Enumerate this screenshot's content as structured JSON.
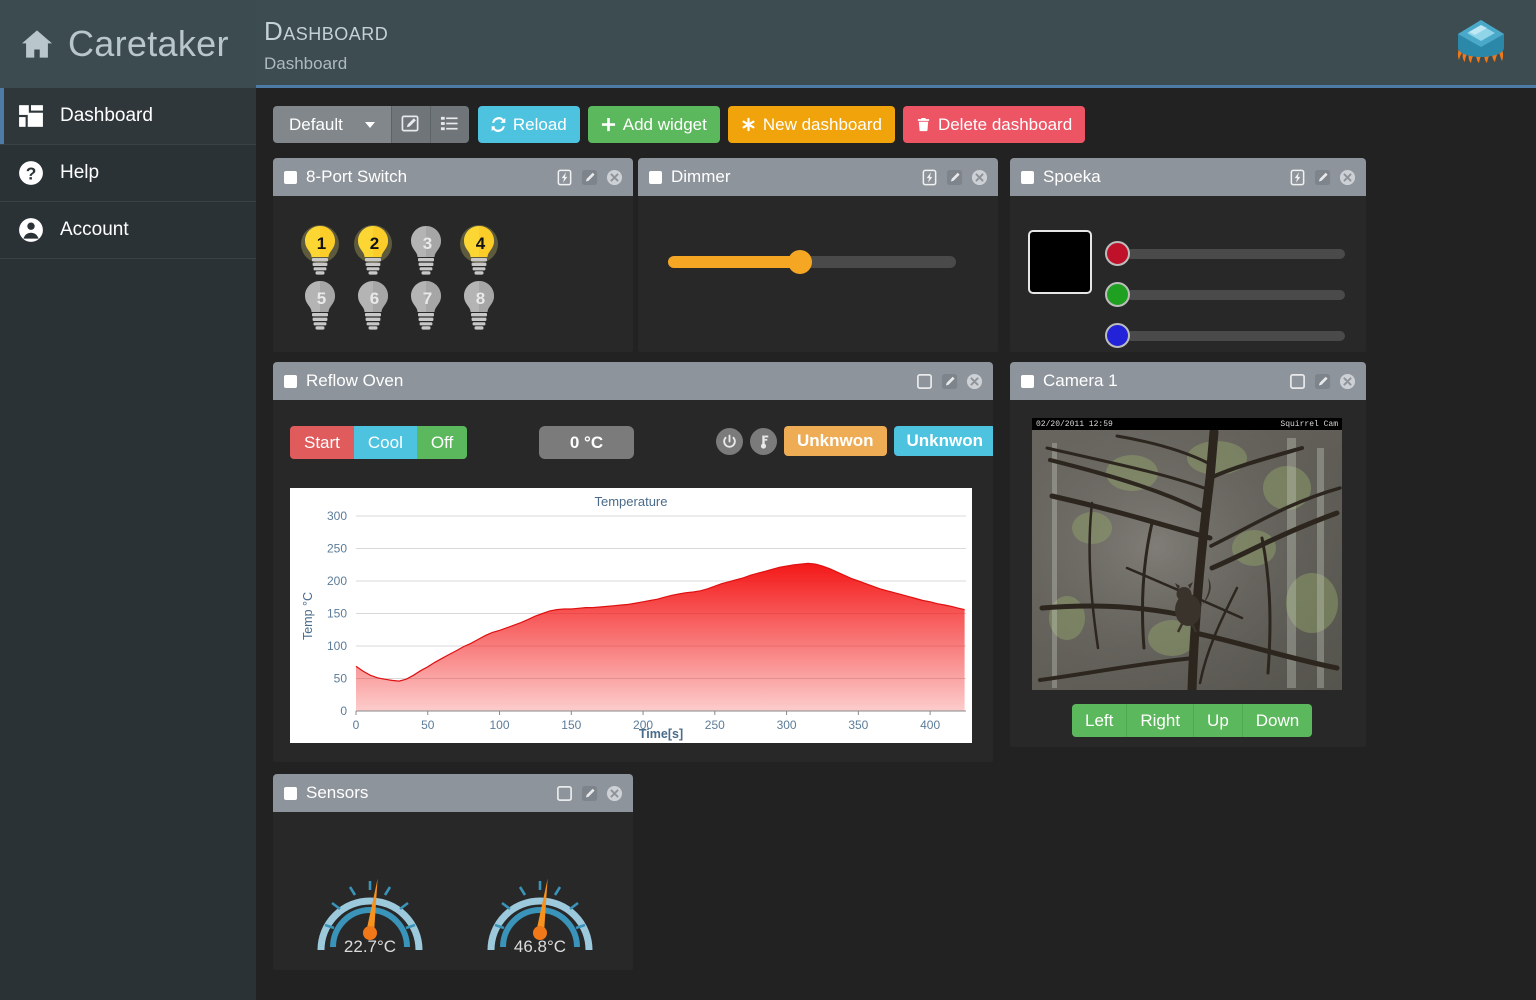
{
  "brand": {
    "name": "Caretaker",
    "home_icon": "home-icon",
    "logo_icon": "chip-flame-logo"
  },
  "header": {
    "title": "Dashboard",
    "subtitle": "Dashboard"
  },
  "sidebar": {
    "items": [
      {
        "label": "Dashboard",
        "icon": "grid-icon",
        "active": true
      },
      {
        "label": "Help",
        "icon": "question-circle-icon",
        "active": false
      },
      {
        "label": "Account",
        "icon": "user-circle-icon",
        "active": false
      }
    ]
  },
  "toolbar": {
    "dashboard_select": {
      "value": "Default",
      "caret_icon": "chevron-down-icon"
    },
    "edit_icon": "edit-square-icon",
    "list_icon": "list-icon",
    "reload_label": "Reload",
    "reload_icon": "refresh-icon",
    "add_widget_label": "Add widget",
    "add_widget_icon": "plus-icon",
    "new_dashboard_label": "New dashboard",
    "new_dashboard_icon": "asterisk-icon",
    "delete_dashboard_label": "Delete dashboard",
    "delete_dashboard_icon": "trash-icon",
    "colors": {
      "reload": "#4ec3e0",
      "add_widget": "#5cb85c",
      "new_dashboard": "#f0a30a",
      "delete_dashboard": "#ed5565"
    }
  },
  "widgets": {
    "switch8": {
      "title": "8-Port Switch",
      "tools": [
        "flash-icon",
        "pencil-icon",
        "close-icon"
      ],
      "bulbs": [
        {
          "num": "1",
          "on": true
        },
        {
          "num": "2",
          "on": true
        },
        {
          "num": "3",
          "on": false
        },
        {
          "num": "4",
          "on": true
        },
        {
          "num": "5",
          "on": false
        },
        {
          "num": "6",
          "on": false
        },
        {
          "num": "7",
          "on": false
        },
        {
          "num": "8",
          "on": false
        }
      ]
    },
    "dimmer": {
      "title": "Dimmer",
      "tools": [
        "flash-icon",
        "pencil-icon",
        "close-icon"
      ],
      "value_percent": 46,
      "fill_color": "#f5a623"
    },
    "spoeka": {
      "title": "Spoeka",
      "tools": [
        "flash-icon",
        "pencil-icon",
        "close-icon"
      ],
      "preview_color": "#000000",
      "channels": [
        {
          "name": "red",
          "color": "#c0112a",
          "value_percent": 0
        },
        {
          "name": "green",
          "color": "#20a020",
          "value_percent": 0
        },
        {
          "name": "blue",
          "color": "#2222d8",
          "value_percent": 0
        }
      ]
    },
    "reflow": {
      "title": "Reflow Oven",
      "tools": [
        "maximize-icon",
        "pencil-icon",
        "close-icon"
      ],
      "buttons": {
        "start": "Start",
        "cool": "Cool",
        "off": "Off"
      },
      "temperature_readout": "0 °C",
      "power_icon": "power-icon",
      "thermometer_icon": "thermometer-icon",
      "status_badges": [
        {
          "label": "Unknwon",
          "color": "#eeac54"
        },
        {
          "label": "Unknwon",
          "color": "#4ec3e0"
        }
      ]
    },
    "camera": {
      "title": "Camera 1",
      "tools": [
        "maximize-icon",
        "pencil-icon",
        "close-icon"
      ],
      "overlay_timestamp": "02/20/2011 12:59",
      "overlay_name": "Squirrel Cam",
      "controls": [
        "Left",
        "Right",
        "Up",
        "Down"
      ]
    },
    "sensors": {
      "title": "Sensors",
      "tools": [
        "maximize-icon",
        "pencil-icon",
        "close-icon"
      ],
      "gauges": [
        {
          "value": "22.7°C",
          "angle_percent": 0.52
        },
        {
          "value": "46.8°C",
          "angle_percent": 0.52
        }
      ]
    }
  },
  "chart_data": {
    "type": "area",
    "title": "Temperature",
    "xlabel": "Time[s]",
    "ylabel": "Temp °C",
    "xlim": [
      0,
      425
    ],
    "ylim": [
      0,
      300
    ],
    "xticks": [
      0,
      50,
      100,
      150,
      200,
      250,
      300,
      350,
      400
    ],
    "yticks": [
      0,
      50,
      100,
      150,
      200,
      250,
      300
    ],
    "grid": true,
    "legend": "none",
    "series": [
      {
        "name": "Temperature",
        "color": "#f41818",
        "x": [
          0,
          5,
          10,
          15,
          20,
          25,
          30,
          35,
          40,
          45,
          50,
          55,
          60,
          65,
          70,
          75,
          80,
          85,
          90,
          95,
          100,
          105,
          110,
          115,
          120,
          125,
          130,
          135,
          140,
          145,
          150,
          155,
          160,
          165,
          170,
          175,
          180,
          185,
          190,
          195,
          200,
          205,
          210,
          215,
          220,
          225,
          230,
          235,
          240,
          245,
          250,
          255,
          260,
          265,
          270,
          275,
          280,
          285,
          290,
          295,
          300,
          305,
          310,
          315,
          320,
          325,
          330,
          335,
          340,
          345,
          350,
          355,
          360,
          365,
          370,
          375,
          380,
          385,
          390,
          395,
          400,
          405,
          410,
          415,
          420,
          424
        ],
        "y": [
          69,
          61,
          55,
          51,
          49,
          47,
          46,
          49,
          55,
          62,
          68,
          75,
          81,
          87,
          93,
          99,
          104,
          110,
          116,
          121,
          124,
          128,
          132,
          136,
          141,
          146,
          150,
          154,
          156,
          157,
          157,
          158,
          159,
          159,
          160,
          161,
          162,
          163,
          164,
          166,
          168,
          170,
          172,
          175,
          178,
          180,
          182,
          183,
          185,
          188,
          192,
          196,
          199,
          202,
          205,
          209,
          212,
          215,
          218,
          221,
          223,
          225,
          226,
          227,
          226,
          223,
          219,
          214,
          209,
          204,
          200,
          196,
          192,
          188,
          185,
          182,
          179,
          176,
          173,
          170,
          168,
          165,
          163,
          161,
          158,
          156
        ]
      }
    ]
  }
}
